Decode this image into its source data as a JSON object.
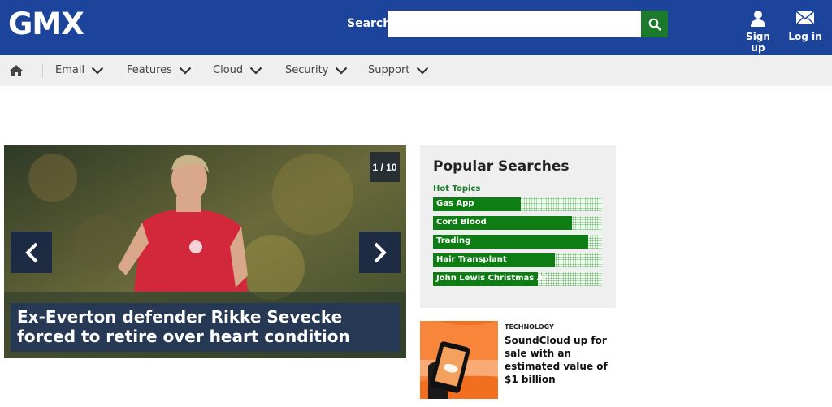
{
  "header": {
    "logo": "GMX",
    "search_label": "Search",
    "search_placeholder": "",
    "signup_label": "Sign up",
    "login_label": "Log in",
    "brand_color": "#1c449b",
    "search_button_color": "#1b7a2c"
  },
  "nav": {
    "items": [
      {
        "label": "Email",
        "icon": "chevron-down-icon"
      },
      {
        "label": "Features",
        "icon": "chevron-down-icon"
      },
      {
        "label": "Cloud",
        "icon": "chevron-down-icon"
      },
      {
        "label": "Security",
        "icon": "chevron-down-icon"
      },
      {
        "label": "Support",
        "icon": "chevron-down-icon"
      }
    ]
  },
  "slider": {
    "counter": "1 / 10",
    "caption": "Ex-Everton defender Rikke Sevecke forced to retire over heart condition"
  },
  "popular": {
    "title": "Popular Searches",
    "subtitle": "Hot Topics",
    "items": [
      {
        "label": "Gas App",
        "fraction": 0.52
      },
      {
        "label": "Cord Blood",
        "fraction": 0.82
      },
      {
        "label": "Trading",
        "fraction": 0.92
      },
      {
        "label": "Hair Transplant",
        "fraction": 0.72
      },
      {
        "label": "John Lewis Christmas Ad...",
        "fraction": 0.62
      }
    ],
    "bar_color": "#0d7d14"
  },
  "article": {
    "category": "TECHNOLOGY",
    "title": "SoundCloud up for sale with an estimated value of $1 billion"
  }
}
